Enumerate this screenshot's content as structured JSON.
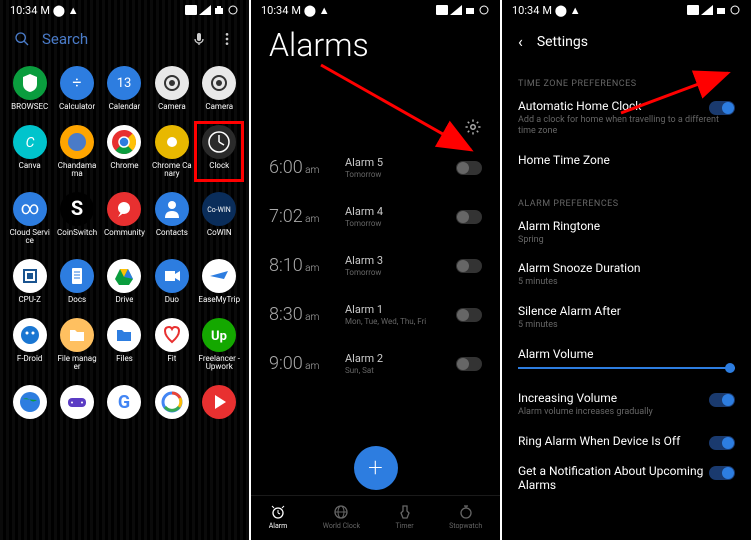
{
  "status": {
    "time": "10:34",
    "indicators": "M ⬤ ▲"
  },
  "phone1": {
    "search": {
      "placeholder": "Search"
    },
    "apps": [
      [
        {
          "label": "BROWSEC",
          "bg": "#0a9d3e",
          "icon": "shield"
        },
        {
          "label": "Calculator",
          "bg": "#2d7de0",
          "icon": "calc"
        },
        {
          "label": "Calendar",
          "bg": "#2d7de0",
          "icon": "cal"
        },
        {
          "label": "Camera",
          "bg": "#e8e8e8",
          "icon": "cam"
        },
        {
          "label": "Camera",
          "bg": "#e8e8e8",
          "icon": "cam"
        }
      ],
      [
        {
          "label": "Canva",
          "bg": "#00c4cc",
          "icon": "canva"
        },
        {
          "label": "Chandamama",
          "bg": "#ffa500",
          "icon": "chand"
        },
        {
          "label": "Chrome",
          "bg": "#fff",
          "icon": "chrome"
        },
        {
          "label": "Chrome Canary",
          "bg": "#e8b800",
          "icon": "chromec"
        },
        {
          "label": "Clock",
          "bg": "#2a2a2a",
          "icon": "clock",
          "highlight": true
        }
      ],
      [
        {
          "label": "Cloud Service",
          "bg": "#2d7de0",
          "icon": "cloud"
        },
        {
          "label": "CoinSwitch",
          "bg": "#000",
          "icon": "coins"
        },
        {
          "label": "Community",
          "bg": "#e83030",
          "icon": "comm"
        },
        {
          "label": "Contacts",
          "bg": "#2d7de0",
          "icon": "cont"
        },
        {
          "label": "CoWIN",
          "bg": "#0a2d5a",
          "icon": "cowin"
        }
      ],
      [
        {
          "label": "CPU-Z",
          "bg": "#fff",
          "icon": "cpu"
        },
        {
          "label": "Docs",
          "bg": "#2d7de0",
          "icon": "docs"
        },
        {
          "label": "Drive",
          "bg": "#fff",
          "icon": "drive"
        },
        {
          "label": "Duo",
          "bg": "#2d7de0",
          "icon": "duo"
        },
        {
          "label": "EaseMyTrip",
          "bg": "#fff",
          "icon": "ease"
        }
      ],
      [
        {
          "label": "F-Droid",
          "bg": "#fff",
          "icon": "fdroid"
        },
        {
          "label": "File manager",
          "bg": "#ffc060",
          "icon": "filem"
        },
        {
          "label": "Files",
          "bg": "#fff",
          "icon": "files"
        },
        {
          "label": "Fit",
          "bg": "#fff",
          "icon": "fit"
        },
        {
          "label": "Freelancer - Upwork",
          "bg": "#14a800",
          "icon": "upwork"
        }
      ],
      [
        {
          "label": "",
          "bg": "#fff",
          "icon": "earth"
        },
        {
          "label": "",
          "bg": "#fff",
          "icon": "game"
        },
        {
          "label": "",
          "bg": "#fff",
          "icon": "g"
        },
        {
          "label": "",
          "bg": "#fff",
          "icon": "google"
        },
        {
          "label": "",
          "bg": "#e83030",
          "icon": "play"
        }
      ]
    ]
  },
  "phone2": {
    "title": "Alarms",
    "alarms": [
      {
        "time": "6:00",
        "ampm": "am",
        "name": "Alarm 5",
        "sub": "Tomorrow"
      },
      {
        "time": "7:02",
        "ampm": "am",
        "name": "Alarm 4",
        "sub": "Tomorrow"
      },
      {
        "time": "8:10",
        "ampm": "am",
        "name": "Alarm 3",
        "sub": "Tomorrow"
      },
      {
        "time": "8:30",
        "ampm": "am",
        "name": "Alarm 1",
        "sub": "Mon, Tue, Wed, Thu, Fri"
      },
      {
        "time": "9:00",
        "ampm": "am",
        "name": "Alarm 2",
        "sub": "Sun, Sat"
      }
    ],
    "nav": [
      {
        "label": "Alarm"
      },
      {
        "label": "World Clock"
      },
      {
        "label": "Timer"
      },
      {
        "label": "Stopwatch"
      }
    ],
    "fab": "+"
  },
  "phone3": {
    "title": "Settings",
    "section1": {
      "label": "TIME ZONE PREFERENCES",
      "autoClock": {
        "title": "Automatic Home Clock",
        "sub": "Add a clock for home when travelling to a different time zone"
      },
      "homeZone": {
        "title": "Home Time Zone"
      }
    },
    "section2": {
      "label": "ALARM PREFERENCES",
      "ringtone": {
        "title": "Alarm Ringtone",
        "sub": "Spring"
      },
      "snooze": {
        "title": "Alarm Snooze Duration",
        "sub": "5 minutes"
      },
      "silence": {
        "title": "Silence Alarm After",
        "sub": "5 minutes"
      },
      "volume": {
        "title": "Alarm Volume"
      },
      "increasing": {
        "title": "Increasing Volume",
        "sub": "Alarm volume increases gradually"
      },
      "ringOff": {
        "title": "Ring Alarm When Device Is Off"
      },
      "notify": {
        "title": "Get a Notification About Upcoming Alarms"
      }
    }
  }
}
